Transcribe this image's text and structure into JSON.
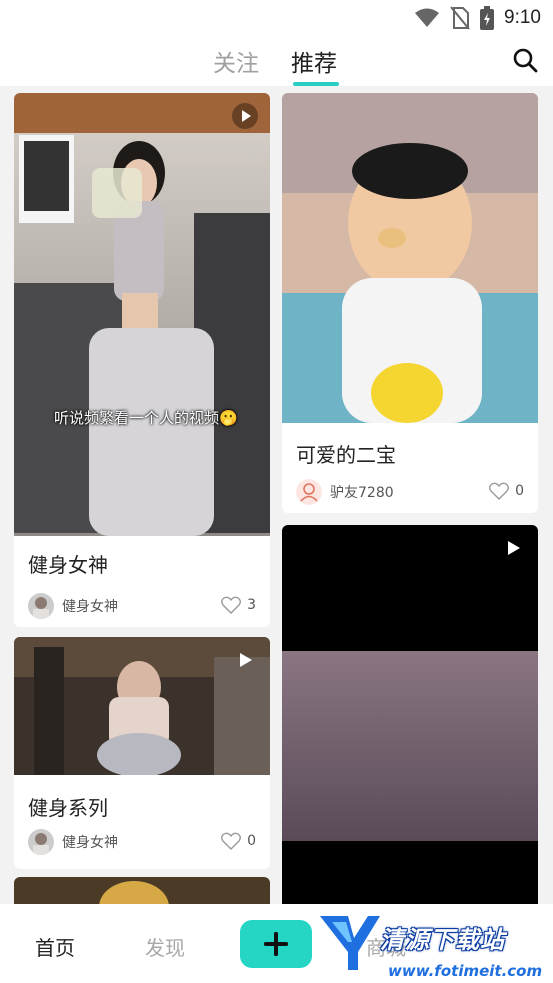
{
  "status_bar": {
    "time": "9:10",
    "icons": [
      "wifi-icon",
      "no-sim-icon",
      "battery-charging-icon"
    ]
  },
  "header": {
    "tabs": [
      {
        "label": "关注",
        "active": false
      },
      {
        "label": "推荐",
        "active": true
      }
    ],
    "accent_color": "#29cfc5",
    "search_icon": "search-icon"
  },
  "feed": {
    "cards": [
      {
        "type": "video",
        "title": "健身女神",
        "caption": "听说频繁看一个人的视频🫢",
        "author": "健身女神",
        "likes": "3"
      },
      {
        "type": "image",
        "title": "可爱的二宝",
        "author": "驴友7280",
        "likes": "0"
      },
      {
        "type": "video",
        "title": "健身系列",
        "author": "健身女神",
        "likes": "0"
      },
      {
        "type": "video",
        "title": "",
        "author": "",
        "likes": ""
      }
    ]
  },
  "bottom_nav": {
    "items": [
      {
        "label": "首页",
        "active": true
      },
      {
        "label": "发现",
        "active": false
      },
      {
        "label": "商城",
        "active": false
      }
    ],
    "add_button_color": "#25d6c4"
  },
  "watermark": {
    "brand": "清源下载站",
    "url": "www.fotimeit.com"
  }
}
